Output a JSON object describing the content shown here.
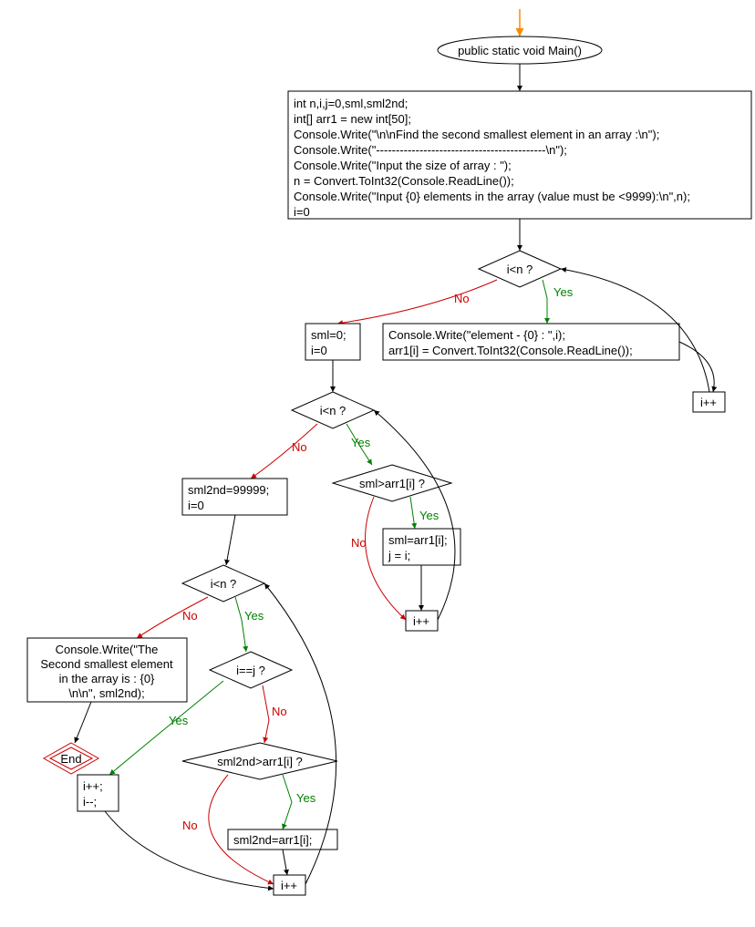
{
  "nodes": {
    "start": {
      "label": "public static void Main()"
    },
    "init": {
      "lines": [
        "int n,i,j=0,sml,sml2nd;",
        "int[] arr1 = new int[50];",
        "Console.Write(\"\\n\\nFind the second smallest element in an array :\\n\");",
        "Console.Write(\"-------------------------------------------\\n\");",
        "Console.Write(\"Input the size of array : \");",
        "n = Convert.ToInt32(Console.ReadLine());",
        "Console.Write(\"Input {0} elements in the array (value must be <9999):\\n\",n);",
        "i=0"
      ]
    },
    "cond1": {
      "label": "i<n ?"
    },
    "input_elem": {
      "lines": [
        "Console.Write(\"element - {0} : \",i);",
        "arr1[i] = Convert.ToInt32(Console.ReadLine());"
      ]
    },
    "incr1": {
      "label": "i++"
    },
    "reset1": {
      "lines": [
        "sml=0;",
        "i=0"
      ]
    },
    "cond2": {
      "label": "i<n ?"
    },
    "cond3": {
      "label": "sml>arr1[i] ?"
    },
    "assign1": {
      "lines": [
        "sml=arr1[i];",
        "j = i;"
      ]
    },
    "incr2": {
      "label": "i++"
    },
    "reset2": {
      "lines": [
        "sml2nd=99999;",
        "i=0"
      ]
    },
    "cond4": {
      "label": "i<n ?"
    },
    "cond5": {
      "label": "i==j ?"
    },
    "cond6": {
      "label": "sml2nd>arr1[i] ?"
    },
    "assign2": {
      "label": "sml2nd=arr1[i];"
    },
    "output": {
      "lines": [
        "Console.Write(\"The",
        "Second smallest element",
        "in the array is :  {0}",
        "\\n\\n\", sml2nd);"
      ]
    },
    "end": {
      "label": "End"
    },
    "incr3": {
      "lines": [
        "i++;",
        "i--;"
      ]
    },
    "incr4": {
      "label": "i++"
    }
  },
  "labels": {
    "yes": "Yes",
    "no": "No"
  }
}
